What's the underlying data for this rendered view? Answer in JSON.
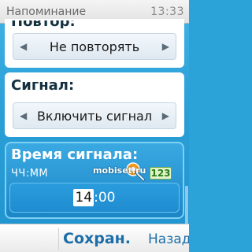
{
  "titlebar": {
    "title": "Напоминание",
    "clock": "13:33"
  },
  "repeat": {
    "label": "Повтор:",
    "value": "Не повторять"
  },
  "signal": {
    "label": "Сигнал:",
    "value": "Включить сигнал"
  },
  "time": {
    "label": "Время сигнала:",
    "format": "ЧЧ:ММ",
    "input_mode": "123",
    "hours": "14",
    "separator": ":",
    "minutes": "00"
  },
  "watermark": "mobiset.ru",
  "softkeys": {
    "left": "Сохран.",
    "right": "Назад"
  },
  "colors": {
    "background": "#2ba3d8",
    "highlight": "#1b86c6",
    "softkey_text": "#1d6ea8",
    "input_mode_bg": "#dff5c8"
  }
}
